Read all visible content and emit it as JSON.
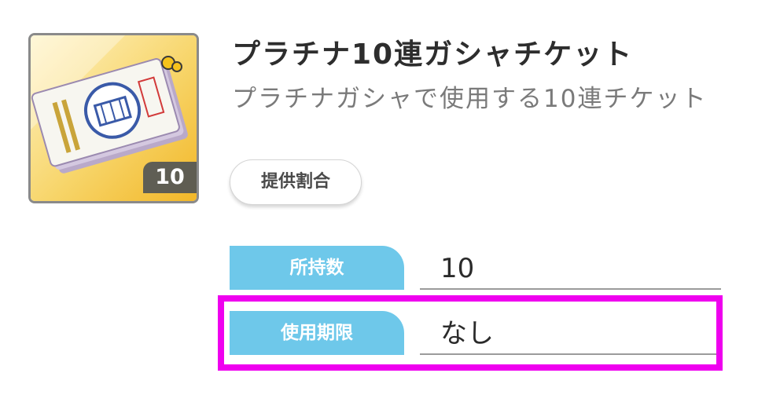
{
  "item": {
    "icon_name": "gasha-ticket-icon",
    "quantity_badge": "10",
    "title": "プラチナ10連ガシャチケット",
    "description": "プラチナガシャで使用する10連チケット"
  },
  "rates_button": {
    "label": "提供割合"
  },
  "info": {
    "owned_label": "所持数",
    "owned_value": "10",
    "expiry_label": "使用期限",
    "expiry_value": "なし"
  },
  "colors": {
    "label_bg": "#6ec8ea",
    "highlight": "#ef00ef",
    "icon_bg": "#f5c94a"
  }
}
